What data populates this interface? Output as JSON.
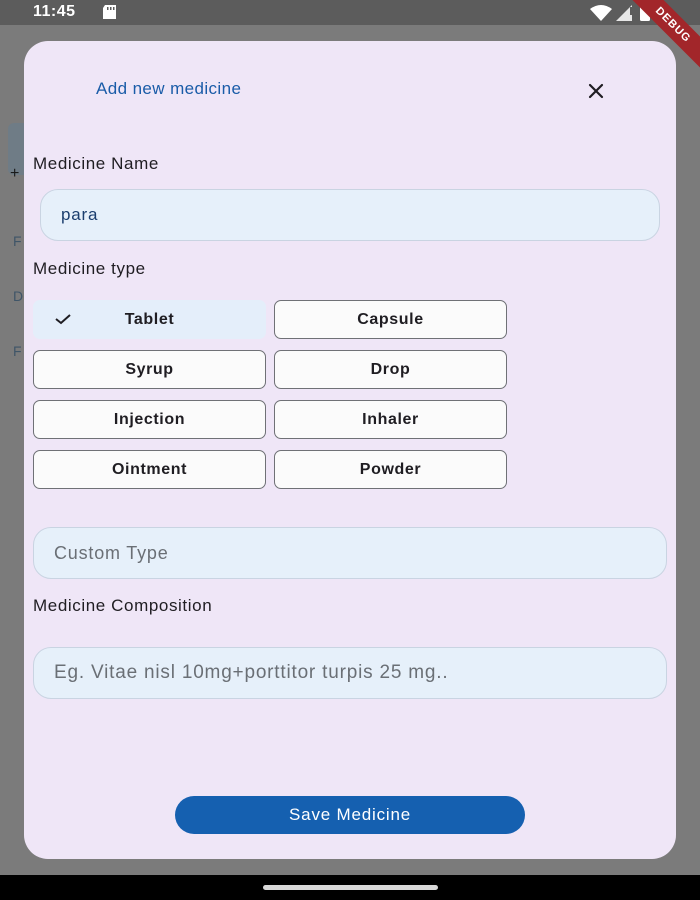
{
  "status_bar": {
    "time": "11:45",
    "icons": [
      "sd-card-icon",
      "wifi-icon",
      "signal-icon",
      "battery-icon"
    ]
  },
  "debug_banner": "DEBUG",
  "background": {
    "letters": [
      "+",
      "F",
      "D",
      "F"
    ]
  },
  "modal": {
    "title": "Add new medicine",
    "close_icon": "close-icon",
    "medicine_name": {
      "label": "Medicine Name",
      "value": "para"
    },
    "medicine_type": {
      "label": "Medicine type",
      "options": [
        {
          "label": "Tablet",
          "selected": true
        },
        {
          "label": "Capsule",
          "selected": false
        },
        {
          "label": "Syrup",
          "selected": false
        },
        {
          "label": "Drop",
          "selected": false
        },
        {
          "label": "Injection",
          "selected": false
        },
        {
          "label": "Inhaler",
          "selected": false
        },
        {
          "label": "Ointment",
          "selected": false
        },
        {
          "label": "Powder",
          "selected": false
        }
      ]
    },
    "custom_type": {
      "placeholder": "Custom Type"
    },
    "composition": {
      "label": "Medicine Composition",
      "placeholder": "Eg. Vitae nisl 10mg+porttitor turpis 25 mg.."
    },
    "save_label": "Save Medicine"
  },
  "colors": {
    "modal_bg": "#efe6f7",
    "accent": "#1560b0",
    "title": "#1a5ca8",
    "input_bg": "#e6f0fa"
  }
}
